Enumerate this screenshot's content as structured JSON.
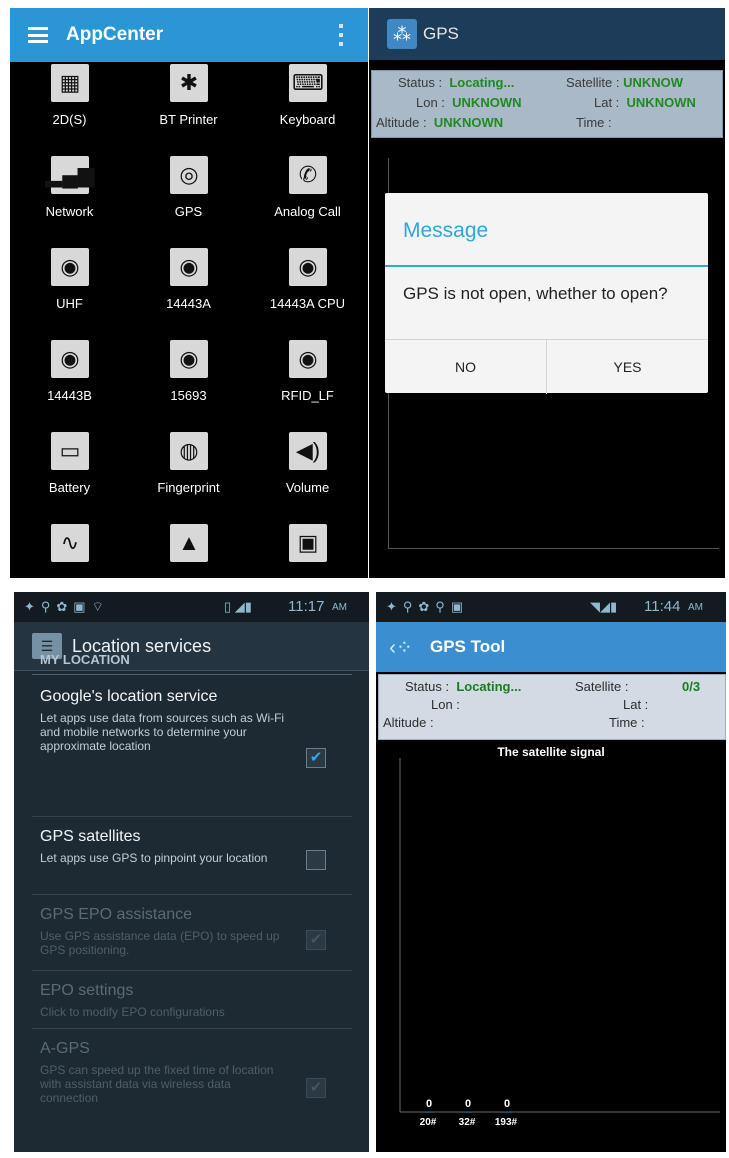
{
  "appcenter": {
    "title": "AppCenter",
    "items": [
      {
        "label": "2D(S)",
        "icon": "qr-code-icon",
        "glyph": "▦"
      },
      {
        "label": "BT Printer",
        "icon": "bluetooth-icon",
        "glyph": "✱"
      },
      {
        "label": "Keyboard",
        "icon": "keyboard-icon",
        "glyph": "⌨"
      },
      {
        "label": "Network",
        "icon": "signal-bars-icon",
        "glyph": "▂▄▆"
      },
      {
        "label": "GPS",
        "icon": "satellite-dish-icon",
        "glyph": "◎"
      },
      {
        "label": "Analog Call",
        "icon": "phone-call-icon",
        "glyph": "✆"
      },
      {
        "label": "UHF",
        "icon": "rfid-icon",
        "glyph": "◉"
      },
      {
        "label": "14443A",
        "icon": "rfid-icon",
        "glyph": "◉"
      },
      {
        "label": "14443A CPU",
        "icon": "rfid-icon",
        "glyph": "◉"
      },
      {
        "label": "14443B",
        "icon": "rfid-icon",
        "glyph": "◉"
      },
      {
        "label": "15693",
        "icon": "rfid-icon",
        "glyph": "◉"
      },
      {
        "label": "RFID_LF",
        "icon": "rfid-icon",
        "glyph": "◉"
      },
      {
        "label": "Battery",
        "icon": "battery-icon",
        "glyph": "▭"
      },
      {
        "label": "Fingerprint",
        "icon": "fingerprint-icon",
        "glyph": "◍"
      },
      {
        "label": "Volume",
        "icon": "speaker-icon",
        "glyph": "◀)"
      },
      {
        "label": "",
        "icon": "waveform-icon",
        "glyph": "∿"
      },
      {
        "label": "",
        "icon": "navigation-arrow-icon",
        "glyph": "▲"
      },
      {
        "label": "",
        "icon": "sim-card-icon",
        "glyph": "▣"
      }
    ]
  },
  "gps_dialog": {
    "title": "GPS",
    "status_label": "Status :",
    "status_value": "Locating...",
    "satellite_label": "Satellite :",
    "satellite_value": "UNKNOW",
    "lon_label": "Lon :",
    "lon_value": "UNKNOWN",
    "lat_label": "Lat :",
    "lat_value": "UNKNOWN",
    "altitude_label": "Altitude :",
    "altitude_value": "UNKNOWN",
    "time_label": "Time :",
    "dialog": {
      "title": "Message",
      "message": "GPS is not open, whether to open?",
      "no": "NO",
      "yes": "YES"
    }
  },
  "location_services": {
    "status_time": "11:17",
    "status_ampm": "AM",
    "title": "Location services",
    "section": "MY LOCATION",
    "items": [
      {
        "title": "Google's location service",
        "desc": "Let apps use data from sources such as Wi-Fi and mobile networks to determine your approximate location",
        "checked": true,
        "enabled": true
      },
      {
        "title": "GPS satellites",
        "desc": "Let apps use GPS to pinpoint your location",
        "checked": false,
        "enabled": true
      },
      {
        "title": "GPS EPO assistance",
        "desc": "Use GPS assistance data (EPO) to speed up GPS positioning.",
        "checked": true,
        "enabled": false
      },
      {
        "title": "EPO settings",
        "desc": "Click to modify EPO configurations",
        "checked": null,
        "enabled": false
      },
      {
        "title": "A-GPS",
        "desc": "GPS can speed up the fixed time of location with assistant data via wireless data connection",
        "checked": true,
        "enabled": false
      }
    ]
  },
  "gps_tool": {
    "status_time": "11:44",
    "status_ampm": "AM",
    "title": "GPS Tool",
    "status_label": "Status :",
    "status_value": "Locating...",
    "satellite_label": "Satellite :",
    "satellite_value": "0/3",
    "lon_label": "Lon :",
    "lat_label": "Lat :",
    "altitude_label": "Altitude :",
    "time_label": "Time :",
    "colors": {
      "bar": "#3b8fd0",
      "value": "#1c7a1c"
    }
  },
  "chart_data": {
    "type": "bar",
    "title": "The satellite signal",
    "categories": [
      "20#",
      "32#",
      "193#"
    ],
    "values": [
      0,
      0,
      0
    ],
    "ylim": [
      0,
      60
    ]
  }
}
